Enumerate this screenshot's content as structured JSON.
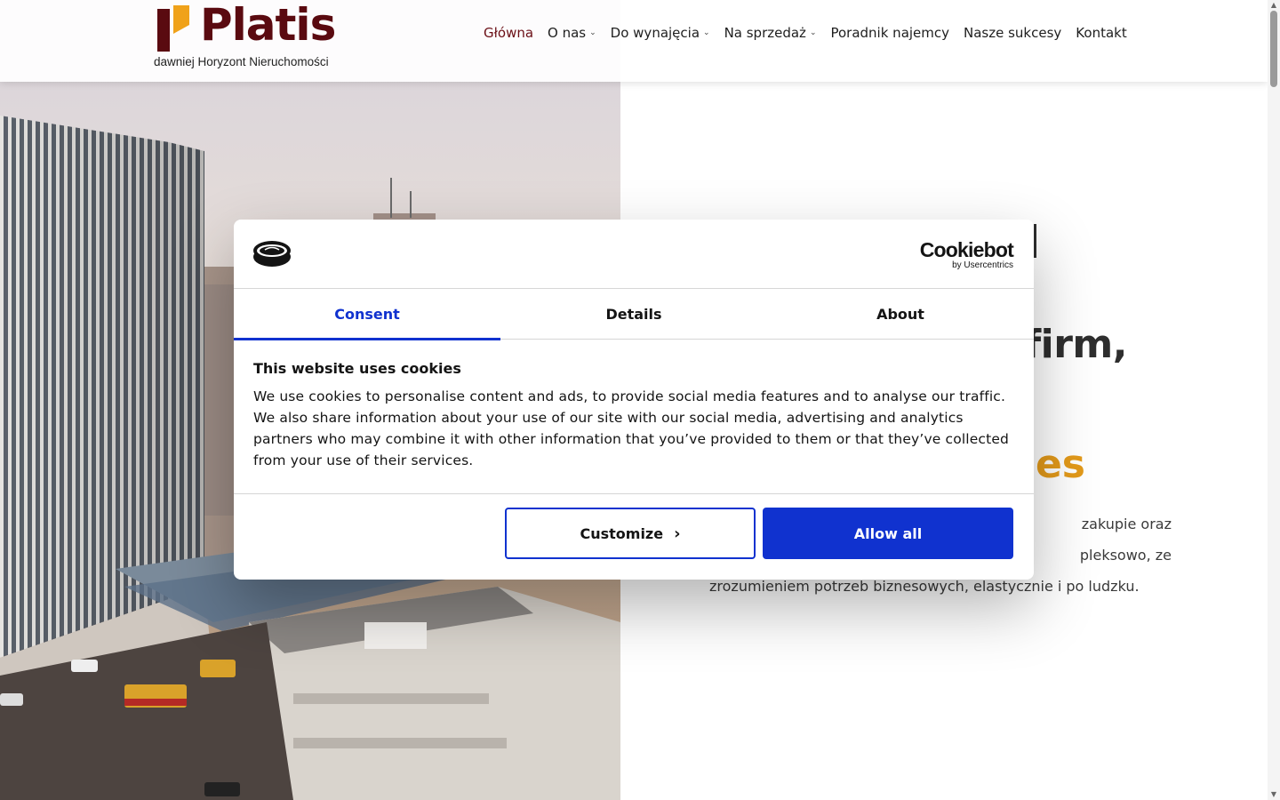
{
  "header": {
    "logo_text": "Platis",
    "logo_subtitle": "dawniej Horyzont Nieruchomości",
    "nav": [
      {
        "label": "Główna",
        "active": true,
        "dropdown": false
      },
      {
        "label": "O nas",
        "active": false,
        "dropdown": true
      },
      {
        "label": "Do wynajęcia",
        "active": false,
        "dropdown": true
      },
      {
        "label": "Na sprzedaż",
        "active": false,
        "dropdown": true
      },
      {
        "label": "Poradnik najemcy",
        "active": false,
        "dropdown": false
      },
      {
        "label": "Nasze sukcesy",
        "active": false,
        "dropdown": false
      },
      {
        "label": "Kontakt",
        "active": false,
        "dropdown": false
      }
    ]
  },
  "hero": {
    "heading_visible": "firm,",
    "accent_visible": "es",
    "paragraph_lines": [
      "zakupie oraz",
      "pleksowo, ze",
      "zrozumieniem potrzeb biznesowych, elastycznie i po ludzku."
    ]
  },
  "cookie": {
    "brand_name": "Cookiebot",
    "brand_sub": "by Usercentrics",
    "tabs": [
      {
        "label": "Consent",
        "active": true
      },
      {
        "label": "Details",
        "active": false
      },
      {
        "label": "About",
        "active": false
      }
    ],
    "title": "This website uses cookies",
    "body": "We use cookies to personalise content and ads, to provide social media features and to analyse our traffic. We also share information about your use of our site with our social media, advertising and analytics partners who may combine it with other information that you’ve provided to them or that they’ve collected from your use of their services.",
    "customize_label": "Customize",
    "allow_label": "Allow all"
  },
  "colors": {
    "brand": "#5a0a10",
    "logo_accent": "#f0a21a",
    "accent_text": "#e39a1a",
    "cookie_blue": "#1032cf"
  },
  "icons": {
    "logo_mark": "platis-logo-icon",
    "cookie_logo": "cookie-consent-icon",
    "dropdown": "chevron-down-icon",
    "customize_arrow": "chevron-right-icon"
  }
}
